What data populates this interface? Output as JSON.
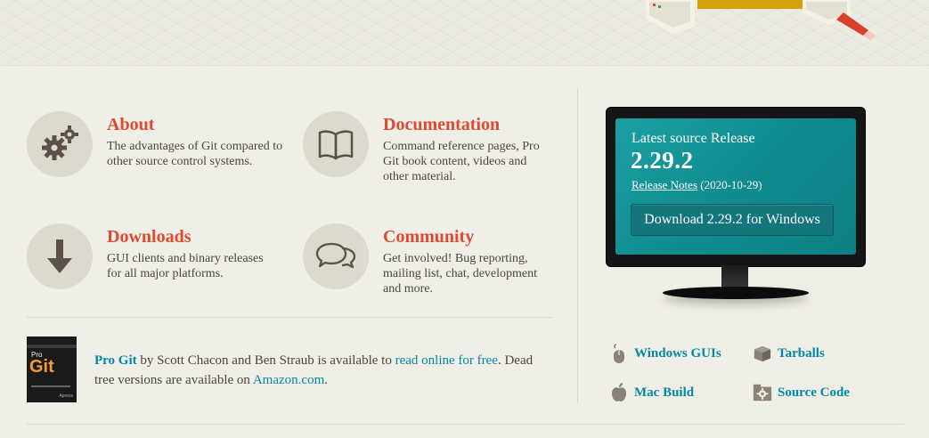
{
  "features": {
    "about": {
      "title": "About",
      "description": "The advantages of Git compared to other source control systems.",
      "icon": "gears-icon"
    },
    "documentation": {
      "title": "Documentation",
      "description": "Command reference pages, Pro Git book content, videos and other material.",
      "icon": "book-icon"
    },
    "downloads": {
      "title": "Downloads",
      "description": "GUI clients and binary releases for all major platforms.",
      "icon": "download-arrow-icon"
    },
    "community": {
      "title": "Community",
      "description": "Get involved! Bug reporting, mailing list, chat, development and more.",
      "icon": "chat-bubbles-icon"
    }
  },
  "book": {
    "cover_pro": "Pro",
    "cover_git": "Git",
    "title_link": "Pro Git",
    "text_1": " by Scott Chacon and Ben Straub is available to ",
    "read_link": "read online for free",
    "text_2": ". Dead tree versions are available on ",
    "amazon_link": "Amazon.com",
    "text_3": "."
  },
  "release": {
    "label": "Latest source Release",
    "version": "2.29.2",
    "notes_link": "Release Notes",
    "date": " (2020-10-29)",
    "download_button": "Download 2.29.2 for Windows"
  },
  "download_links": {
    "windows_guis": "Windows GUIs",
    "tarballs": "Tarballs",
    "mac_build": "Mac Build",
    "source_code": "Source Code"
  },
  "colors": {
    "accent_red": "#e0492f",
    "link_teal": "#0388a6",
    "screen_teal": "#1a9fa3",
    "background": "#f0efe7"
  }
}
